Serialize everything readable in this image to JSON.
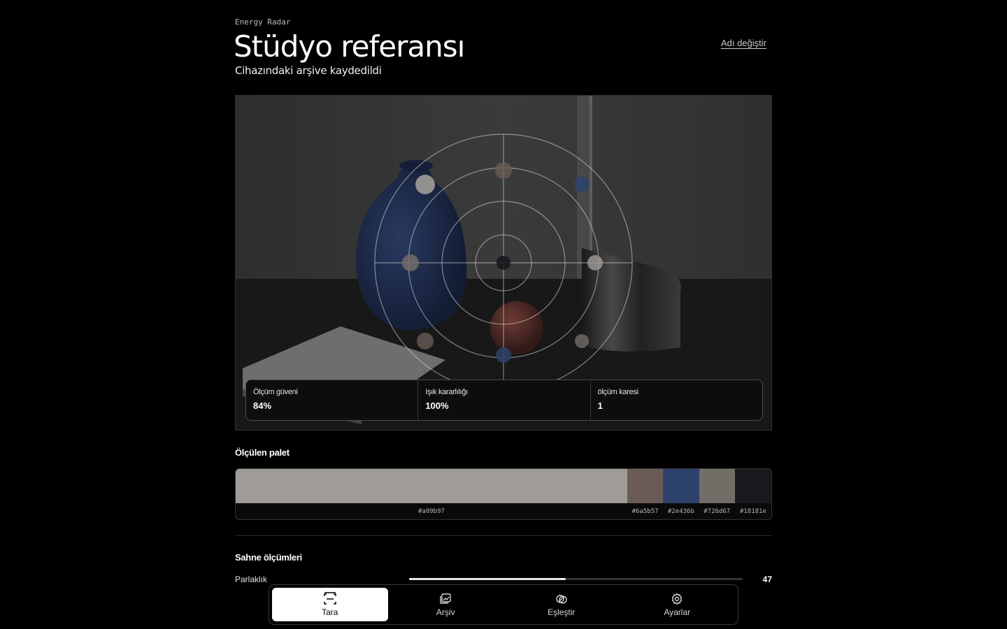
{
  "header": {
    "app_label": "Energy Radar",
    "title": "Stüdyo referansı",
    "subtitle": "Cihazındaki arşive kaydedildi",
    "rename_label": "Adı değiştir"
  },
  "metrics": [
    {
      "label": "Ölçüm güveni",
      "value": "84%"
    },
    {
      "label": "Işık kararlılığı",
      "value": "100%"
    },
    {
      "label": "ölçüm karesi",
      "value": "1"
    }
  ],
  "palette": {
    "title": "Ölçülen palet",
    "colors": [
      {
        "hex": "#a09b97",
        "share": 0.731
      },
      {
        "hex": "#6a5b57",
        "share": 0.067
      },
      {
        "hex": "#2e436b",
        "share": 0.067
      },
      {
        "hex": "#726d67",
        "share": 0.067
      },
      {
        "hex": "#18181e",
        "share": 0.068
      }
    ]
  },
  "scene": {
    "title": "Sahne ölçümleri",
    "rows": [
      {
        "label": "Parlaklık",
        "value": "47",
        "level": 0.47
      }
    ]
  },
  "nav": {
    "items": [
      {
        "label": "Tara",
        "icon": "scan-icon",
        "active": true
      },
      {
        "label": "Arşiv",
        "icon": "gallery-icon",
        "active": false
      },
      {
        "label": "Eşleştir",
        "icon": "match-icon",
        "active": false
      },
      {
        "label": "Ayarlar",
        "icon": "gear-icon",
        "active": false
      }
    ]
  }
}
